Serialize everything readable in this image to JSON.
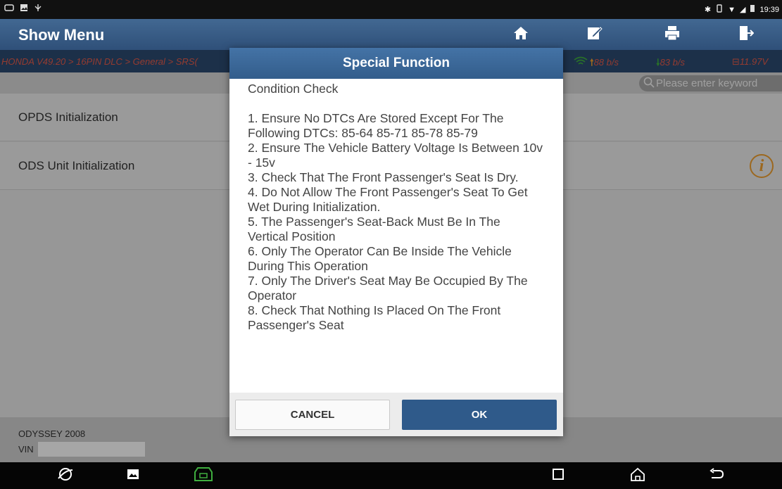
{
  "status_bar": {
    "time": "19:39"
  },
  "header": {
    "title": "Show Menu",
    "icons": [
      "home-icon",
      "edit-report-icon",
      "print-icon",
      "exit-icon"
    ]
  },
  "breadcrumb": {
    "path": "HONDA V49.20 > 16PIN DLC > General > SRS(",
    "upload_rate": "88 b/s",
    "download_rate": "83 b/s",
    "battery_voltage": "11.97V"
  },
  "search": {
    "placeholder": "Please enter keyword"
  },
  "menu": {
    "items": [
      {
        "label": "OPDS Initialization"
      },
      {
        "label": "ODS Unit Initialization"
      }
    ]
  },
  "footer": {
    "vehicle": "ODYSSEY 2008",
    "vin_label": "VIN"
  },
  "dialog": {
    "title": "Special Function",
    "body": "Condition Check\n\n1. Ensure No DTCs Are Stored Except For The Following DTCs: 85-64 85-71 85-78 85-79\n2. Ensure The Vehicle Battery Voltage Is Between 10v - 15v\n3. Check That The Front Passenger's Seat Is Dry.\n4. Do Not Allow The Front Passenger's Seat To Get Wet During Initialization.\n5. The Passenger's Seat-Back Must Be In The Vertical Position\n6. Only The Operator Can Be Inside The Vehicle During This Operation\n7. Only The Driver's Seat May Be Occupied By The Operator\n8. Check That Nothing Is Placed On The Front Passenger's Seat",
    "cancel_label": "CANCEL",
    "ok_label": "OK"
  },
  "colors": {
    "header": "#3a5f8a",
    "breadcrumb_text": "#e35b4a",
    "rate_up": "#f0a030",
    "rate_down": "#3fae3f",
    "ok_button": "#2f5a8a"
  }
}
